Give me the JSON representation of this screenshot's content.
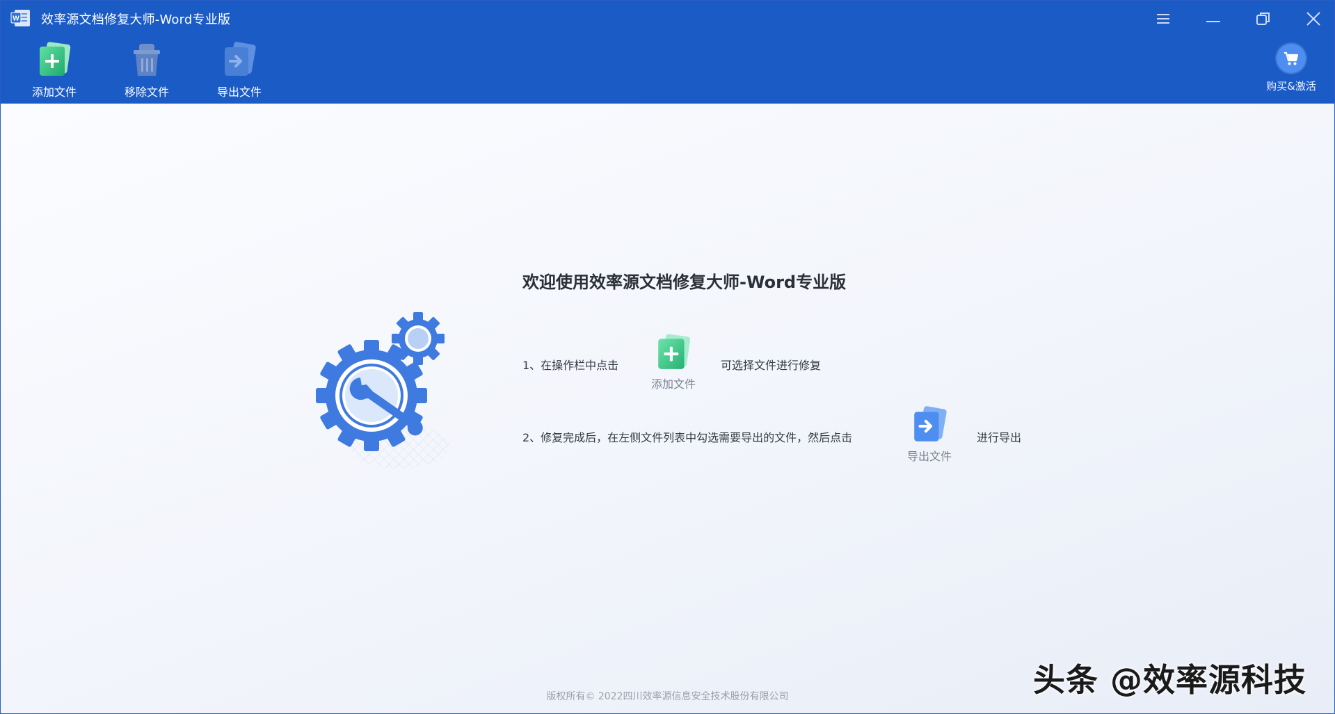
{
  "window": {
    "title": "效率源文档修复大师-Word专业版"
  },
  "toolbar": {
    "add_label": "添加文件",
    "remove_label": "移除文件",
    "export_label": "导出文件",
    "buy_label": "购买&激活"
  },
  "welcome": {
    "title": "欢迎使用效率源文档修复大师-Word专业版",
    "step1_prefix": "1、在操作栏中点击",
    "step1_button": "添加文件",
    "step1_suffix": "可选择文件进行修复",
    "step2_prefix": "2、修复完成后，在左侧文件列表中勾选需要导出的文件，然后点击",
    "step2_button": "导出文件",
    "step2_suffix": "进行导出"
  },
  "footer": {
    "copyright": "版权所有© 2022四川效率源信息安全技术股份有限公司"
  },
  "watermark": {
    "text": "头条 @效率源科技"
  },
  "icons": {
    "app": "word-doc-icon",
    "menu": "menu-icon",
    "minimize": "minimize-icon",
    "restore": "restore-icon",
    "close": "close-icon",
    "add": "add-file-icon",
    "remove": "trash-icon",
    "export": "export-file-icon",
    "cart": "cart-icon",
    "illustration": "gear-wrench-icon"
  },
  "colors": {
    "header": "#1b5bc6",
    "accent_green": "#3fcf8e",
    "accent_blue": "#4d8ef0"
  }
}
